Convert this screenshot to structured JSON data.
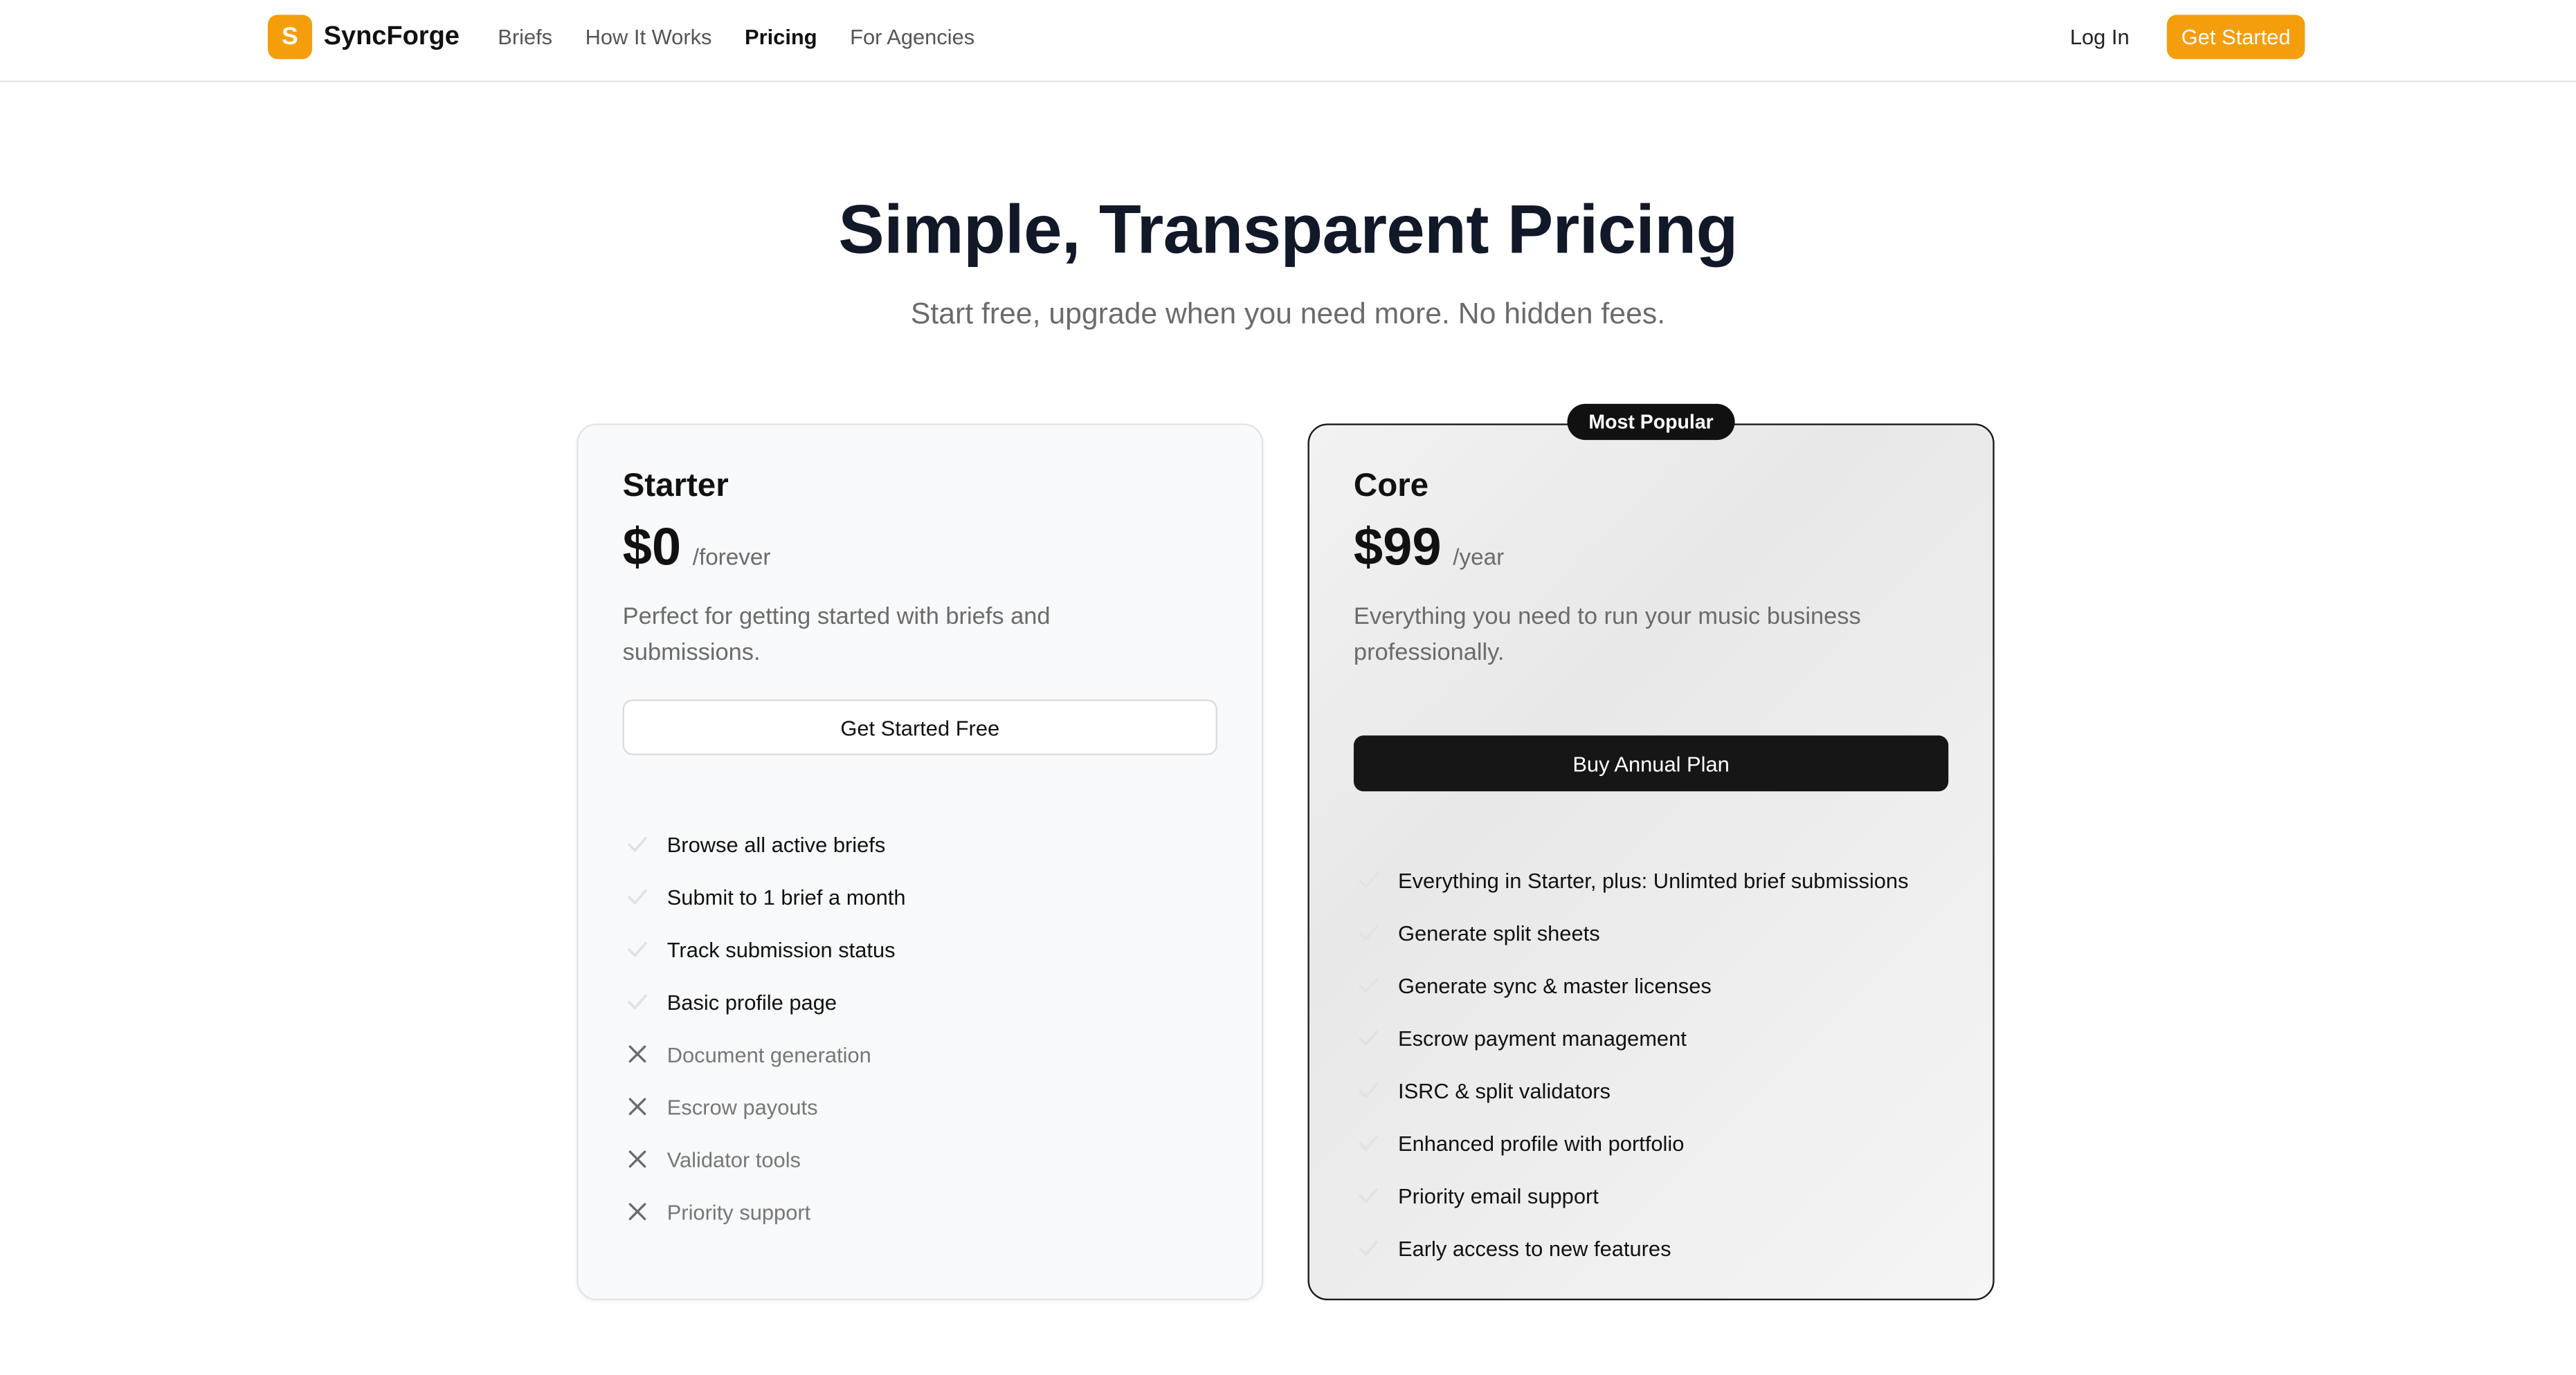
{
  "brand": {
    "logo_letter": "S",
    "name": "SyncForge",
    "accent": "#f59e0b"
  },
  "nav": {
    "links": [
      {
        "label": "Briefs"
      },
      {
        "label": "How It Works"
      },
      {
        "label": "Pricing",
        "active": true
      },
      {
        "label": "For Agencies"
      }
    ],
    "login_label": "Log In",
    "cta_label": "Get Started"
  },
  "hero": {
    "title": "Simple, Transparent Pricing",
    "subtitle": "Start free, upgrade when you need more. No hidden fees."
  },
  "plans": [
    {
      "name": "Starter",
      "price": "$0",
      "period": "/forever",
      "description": "Perfect for getting started with briefs and submissions.",
      "button_label": "Get Started Free",
      "features": [
        {
          "text": "Browse all active briefs",
          "icon": "check-icon",
          "included": true
        },
        {
          "text": "Submit to 1 brief a month",
          "icon": "check-icon",
          "included": true
        },
        {
          "text": "Track submission status",
          "icon": "check-icon",
          "included": true
        },
        {
          "text": "Basic profile page",
          "icon": "check-icon",
          "included": true
        },
        {
          "text": "Document generation",
          "icon": "x-icon",
          "included": false
        },
        {
          "text": "Escrow payouts",
          "icon": "x-icon",
          "included": false
        },
        {
          "text": "Validator tools",
          "icon": "x-icon",
          "included": false
        },
        {
          "text": "Priority support",
          "icon": "x-icon",
          "included": false
        }
      ]
    },
    {
      "name": "Core",
      "badge": "Most Popular",
      "price": "$99",
      "period": "/year",
      "description": "Everything you need to run your music business professionally.",
      "button_label": "Buy Annual Plan",
      "features": [
        {
          "text": "Everything in Starter, plus: Unlimted brief submissions",
          "icon": "check-icon",
          "included": true
        },
        {
          "text": "Generate split sheets",
          "icon": "check-icon",
          "included": true
        },
        {
          "text": "Generate sync & master licenses",
          "icon": "check-icon",
          "included": true
        },
        {
          "text": "Escrow payment management",
          "icon": "check-icon",
          "included": true
        },
        {
          "text": "ISRC & split validators",
          "icon": "check-icon",
          "included": true
        },
        {
          "text": "Enhanced profile with portfolio",
          "icon": "check-icon",
          "included": true
        },
        {
          "text": "Priority email support",
          "icon": "check-icon",
          "included": true
        },
        {
          "text": "Early access to new features",
          "icon": "check-icon",
          "included": true
        }
      ]
    }
  ]
}
